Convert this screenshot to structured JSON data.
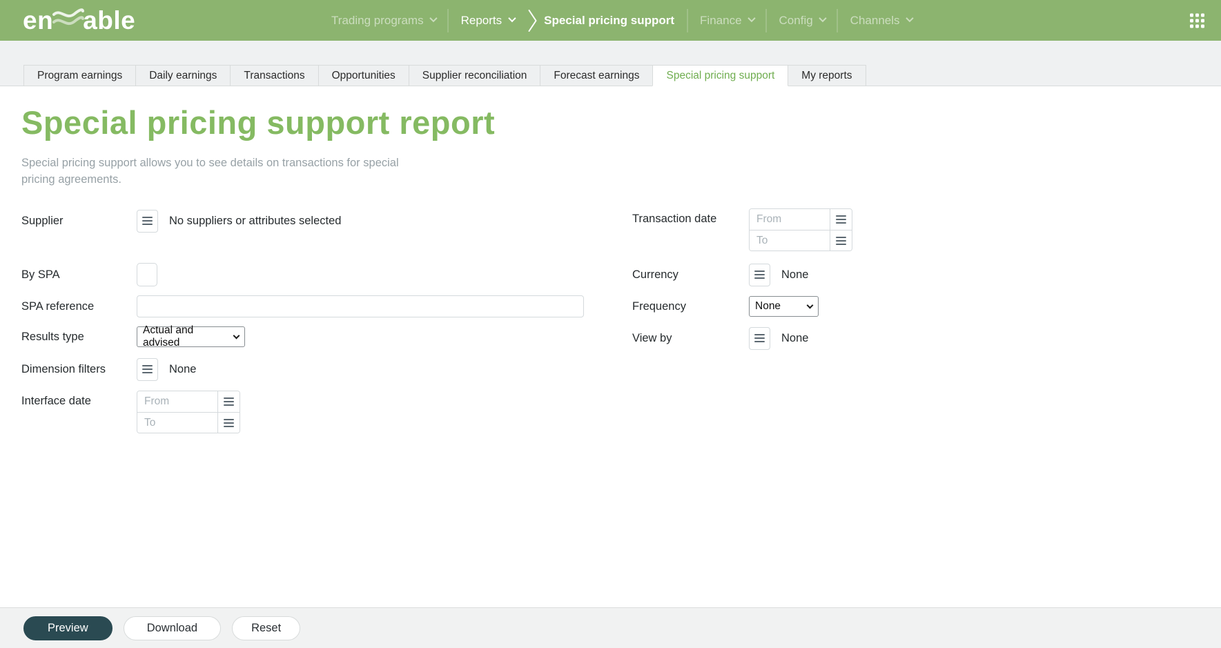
{
  "colors": {
    "navbar_green": "#8cb46f",
    "accent_green": "#85ba62",
    "active_tab_green": "#6fad4f",
    "primary_button_dark": "#2a4a52",
    "band_gray": "#eff1f2",
    "muted_text": "#97a1a6"
  },
  "navbar": {
    "logo": {
      "prefix": "en",
      "suffix": "able"
    },
    "items": [
      {
        "label": "Trading programs",
        "muted": true
      },
      {
        "label": "Reports",
        "muted": false
      },
      {
        "label": "Special pricing support",
        "muted": false
      },
      {
        "label": "Finance",
        "muted": true
      },
      {
        "label": "Config",
        "muted": true
      },
      {
        "label": "Channels",
        "muted": true
      }
    ],
    "icons": {
      "grid": "grid-icon (3x3 dots)",
      "chevron": "chevron-down-icon",
      "breadcrumb": "breadcrumb-chevron-icon"
    }
  },
  "tabs": {
    "items": [
      "Program earnings",
      "Daily earnings",
      "Transactions",
      "Opportunities",
      "Supplier reconciliation",
      "Forecast earnings",
      "Special pricing support",
      "My reports"
    ],
    "active": "Special pricing support",
    "active_index": 6
  },
  "page": {
    "title": "Special pricing support report",
    "description": "Special pricing support allows you to see details on transactions for special pricing agreements."
  },
  "form": {
    "supplier": {
      "label": "Supplier",
      "value": "No suppliers or attributes selected",
      "icon": "hamburger-icon"
    },
    "by_spa": {
      "label": "By SPA",
      "checked": false
    },
    "spa_reference": {
      "label": "SPA reference",
      "value": ""
    },
    "results_type": {
      "label": "Results type",
      "value": "Actual and advised"
    },
    "dimension_filters": {
      "label": "Dimension filters",
      "value": "None",
      "icon": "hamburger-icon"
    },
    "interface_date": {
      "label": "Interface date",
      "from_placeholder": "From",
      "to_placeholder": "To",
      "from_value": "",
      "to_value": ""
    },
    "transaction_date": {
      "label": "Transaction date",
      "from_placeholder": "From",
      "to_placeholder": "To",
      "from_value": "",
      "to_value": ""
    },
    "currency": {
      "label": "Currency",
      "value": "None",
      "icon": "hamburger-icon"
    },
    "frequency": {
      "label": "Frequency",
      "value": "None"
    },
    "view_by": {
      "label": "View by",
      "value": "None",
      "icon": "hamburger-icon"
    }
  },
  "footer": {
    "preview_label": "Preview",
    "download_label": "Download",
    "reset_label": "Reset"
  }
}
